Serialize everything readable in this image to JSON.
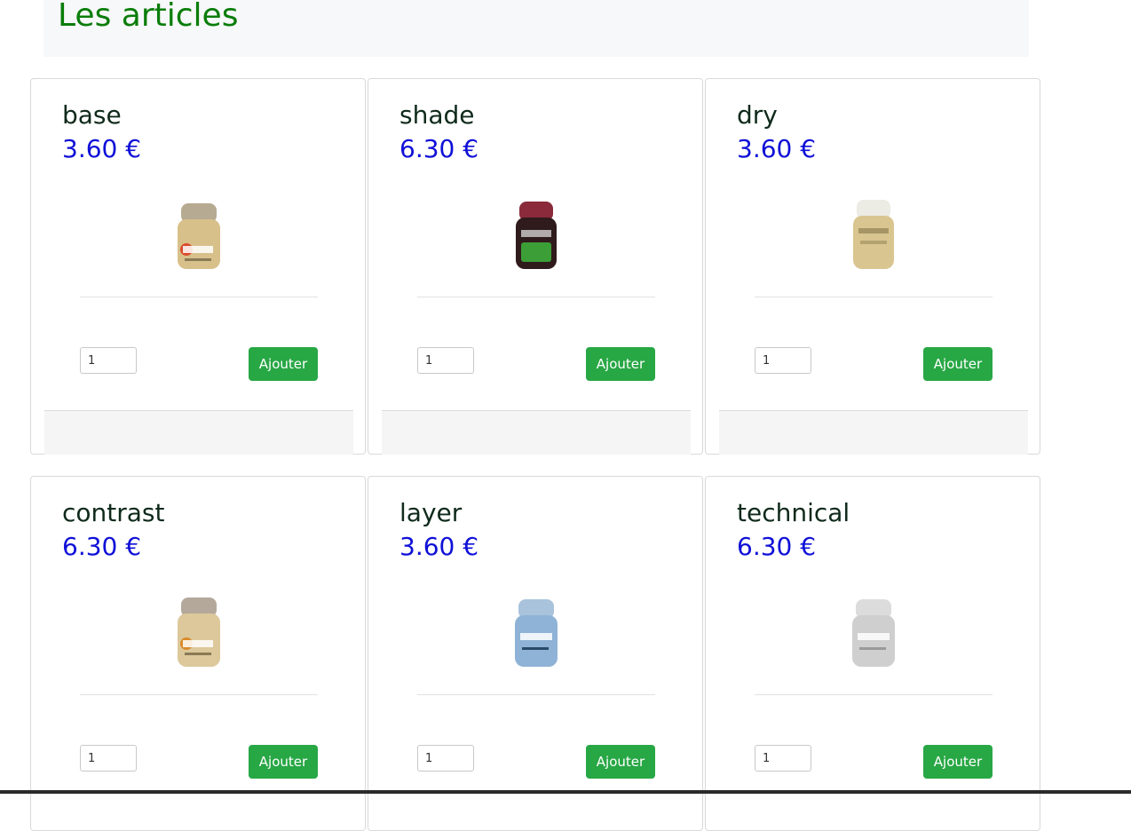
{
  "page": {
    "title": "Les articles"
  },
  "products": [
    {
      "name": "base",
      "price": "3.60 €",
      "qty": "1",
      "button": "Ajouter",
      "image": "base-paint-pot-icon",
      "pot_color": "#d8c08a"
    },
    {
      "name": "shade",
      "price": "6.30 €",
      "qty": "1",
      "button": "Ajouter",
      "image": "shade-paint-pot-icon",
      "pot_color": "#2f1a1c"
    },
    {
      "name": "dry",
      "price": "3.60 €",
      "qty": "1",
      "button": "Ajouter",
      "image": "dry-paint-pot-icon",
      "pot_color": "#d9c58f"
    },
    {
      "name": "contrast",
      "price": "6.30 €",
      "qty": "1",
      "button": "Ajouter",
      "image": "contrast-paint-pot-icon",
      "pot_color": "#dcc89a"
    },
    {
      "name": "layer",
      "price": "3.60 €",
      "qty": "1",
      "button": "Ajouter",
      "image": "layer-paint-pot-icon",
      "pot_color": "#8fb3d6"
    },
    {
      "name": "technical",
      "price": "6.30 €",
      "qty": "1",
      "button": "Ajouter",
      "image": "technical-paint-pot-icon",
      "pot_color": "#cfcfcf"
    }
  ],
  "colors": {
    "accent_green": "#28a745",
    "title_green": "#0a7d0a",
    "price_blue": "#1010d8"
  }
}
